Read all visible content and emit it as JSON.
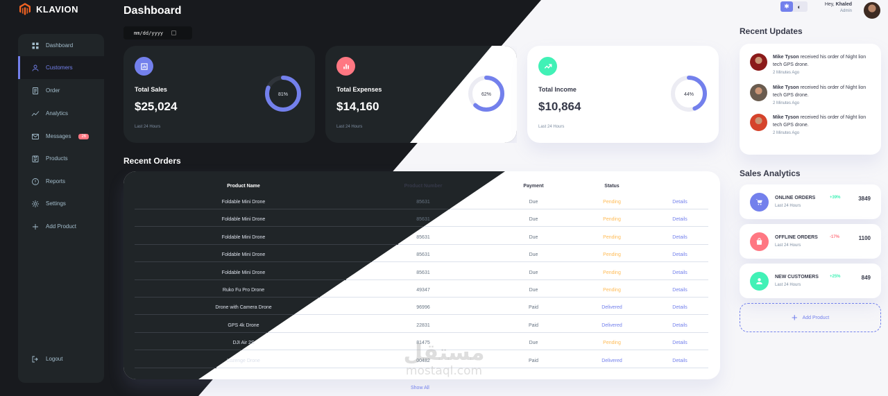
{
  "brand": {
    "name": "KLAVION"
  },
  "sidebar": {
    "items": [
      {
        "label": "Dashboard",
        "icon": "grid-icon",
        "active": false
      },
      {
        "label": "Customers",
        "icon": "user-icon",
        "active": true
      },
      {
        "label": "Order",
        "icon": "receipt-icon",
        "active": false
      },
      {
        "label": "Analytics",
        "icon": "analytics-icon",
        "active": false
      },
      {
        "label": "Messages",
        "icon": "mail-icon",
        "active": false,
        "badge": "26"
      },
      {
        "label": "Products",
        "icon": "inventory-icon",
        "active": false
      },
      {
        "label": "Reports",
        "icon": "report-icon",
        "active": false
      },
      {
        "label": "Settings",
        "icon": "gear-icon",
        "active": false
      },
      {
        "label": "Add Product",
        "icon": "plus-icon",
        "active": false
      }
    ],
    "logout": "Logout"
  },
  "header": {
    "title": "Dashboard",
    "date_placeholder": "mm/dd/yyyy",
    "greeting_prefix": "Hey,",
    "user_name": "Khaled",
    "user_role": "Admin"
  },
  "insights": [
    {
      "label": "Total Sales",
      "amount": "$25,024",
      "percent_label": "81%",
      "percent": 81,
      "sub": "Last 24 Hours",
      "icon": "bar-chart-icon",
      "color": "#7380ec"
    },
    {
      "label": "Total Expenses",
      "amount": "$14,160",
      "percent_label": "62%",
      "percent": 62,
      "sub": "Last 24 Hours",
      "icon": "bar-chart-icon",
      "color": "#ff7782"
    },
    {
      "label": "Total Income",
      "amount": "$10,864",
      "percent_label": "44%",
      "percent": 44,
      "sub": "Last 24 Hours",
      "icon": "trend-icon",
      "color": "#41f1b6"
    }
  ],
  "orders": {
    "title": "Recent Orders",
    "columns": [
      "Product Name",
      "Product Number",
      "Payment",
      "Status",
      ""
    ],
    "rows": [
      {
        "name": "Foldable Mini Drone",
        "number": "85631",
        "payment": "Due",
        "status": "Pending",
        "action": "Details"
      },
      {
        "name": "Foldable Mini Drone",
        "number": "85631",
        "payment": "Due",
        "status": "Pending",
        "action": "Details"
      },
      {
        "name": "Foldable Mini Drone",
        "number": "85631",
        "payment": "Due",
        "status": "Pending",
        "action": "Details"
      },
      {
        "name": "Foldable Mini Drone",
        "number": "85631",
        "payment": "Due",
        "status": "Pending",
        "action": "Details"
      },
      {
        "name": "Foldable Mini Drone",
        "number": "85631",
        "payment": "Due",
        "status": "Pending",
        "action": "Details"
      },
      {
        "name": "Ruko Fu Pro Drone",
        "number": "49347",
        "payment": "Due",
        "status": "Pending",
        "action": "Details"
      },
      {
        "name": "Drone with Camera Drone",
        "number": "96996",
        "payment": "Paid",
        "status": "Delivered",
        "action": "Details"
      },
      {
        "name": "GPS 4k Drone",
        "number": "22831",
        "payment": "Paid",
        "status": "Delivered",
        "action": "Details"
      },
      {
        "name": "DJI Air 2S",
        "number": "81475",
        "payment": "Due",
        "status": "Pending",
        "action": "Details"
      },
      {
        "name": "Lozenge Drone",
        "number": "00482",
        "payment": "Paid",
        "status": "Delivered",
        "action": "Details"
      }
    ],
    "show_all": "Show All"
  },
  "updates": {
    "title": "Recent Updates",
    "items": [
      {
        "name": "Mike Tyson",
        "text": " received his order of Night lion tech GPS drone.",
        "time": "2 Minutes Ago",
        "avatar_color": "#8b1a1a"
      },
      {
        "name": "Mike Tyson",
        "text": " received his order of Night lion tech GPS drone.",
        "time": "2 Minutes Ago",
        "avatar_color": "#6a5c4f"
      },
      {
        "name": "Mike Tyson",
        "text": " received his order of Night lion tech GPS drone.",
        "time": "2 Minutes Ago",
        "avatar_color": "#d5432b"
      }
    ]
  },
  "analytics": {
    "title": "Sales Analytics",
    "items": [
      {
        "label": "ONLINE ORDERS",
        "sub": "Last 24 Hours",
        "pct": "+39%",
        "value": "3849",
        "icon": "cart-icon",
        "color": "#7380ec",
        "pct_color": "#41f1b6"
      },
      {
        "label": "OFFLINE ORDERS",
        "sub": "Last 24 Hours",
        "pct": "-17%",
        "value": "1100",
        "icon": "bag-icon",
        "color": "#ff7782",
        "pct_color": "#ff7782"
      },
      {
        "label": "NEW CUSTOMERS",
        "sub": "Last 24 Hours",
        "pct": "+25%",
        "value": "849",
        "icon": "person-icon",
        "color": "#41f1b6",
        "pct_color": "#41f1b6"
      }
    ],
    "add_product": "Add Product"
  },
  "watermark": {
    "arabic": "مستقل",
    "latin": "mostaql.com"
  },
  "colors": {
    "primary": "#7380ec",
    "danger": "#ff7782",
    "success": "#41f1b6",
    "warning": "#ffbb55",
    "dark_bg": "#181a1e",
    "dark_card": "#202528"
  }
}
